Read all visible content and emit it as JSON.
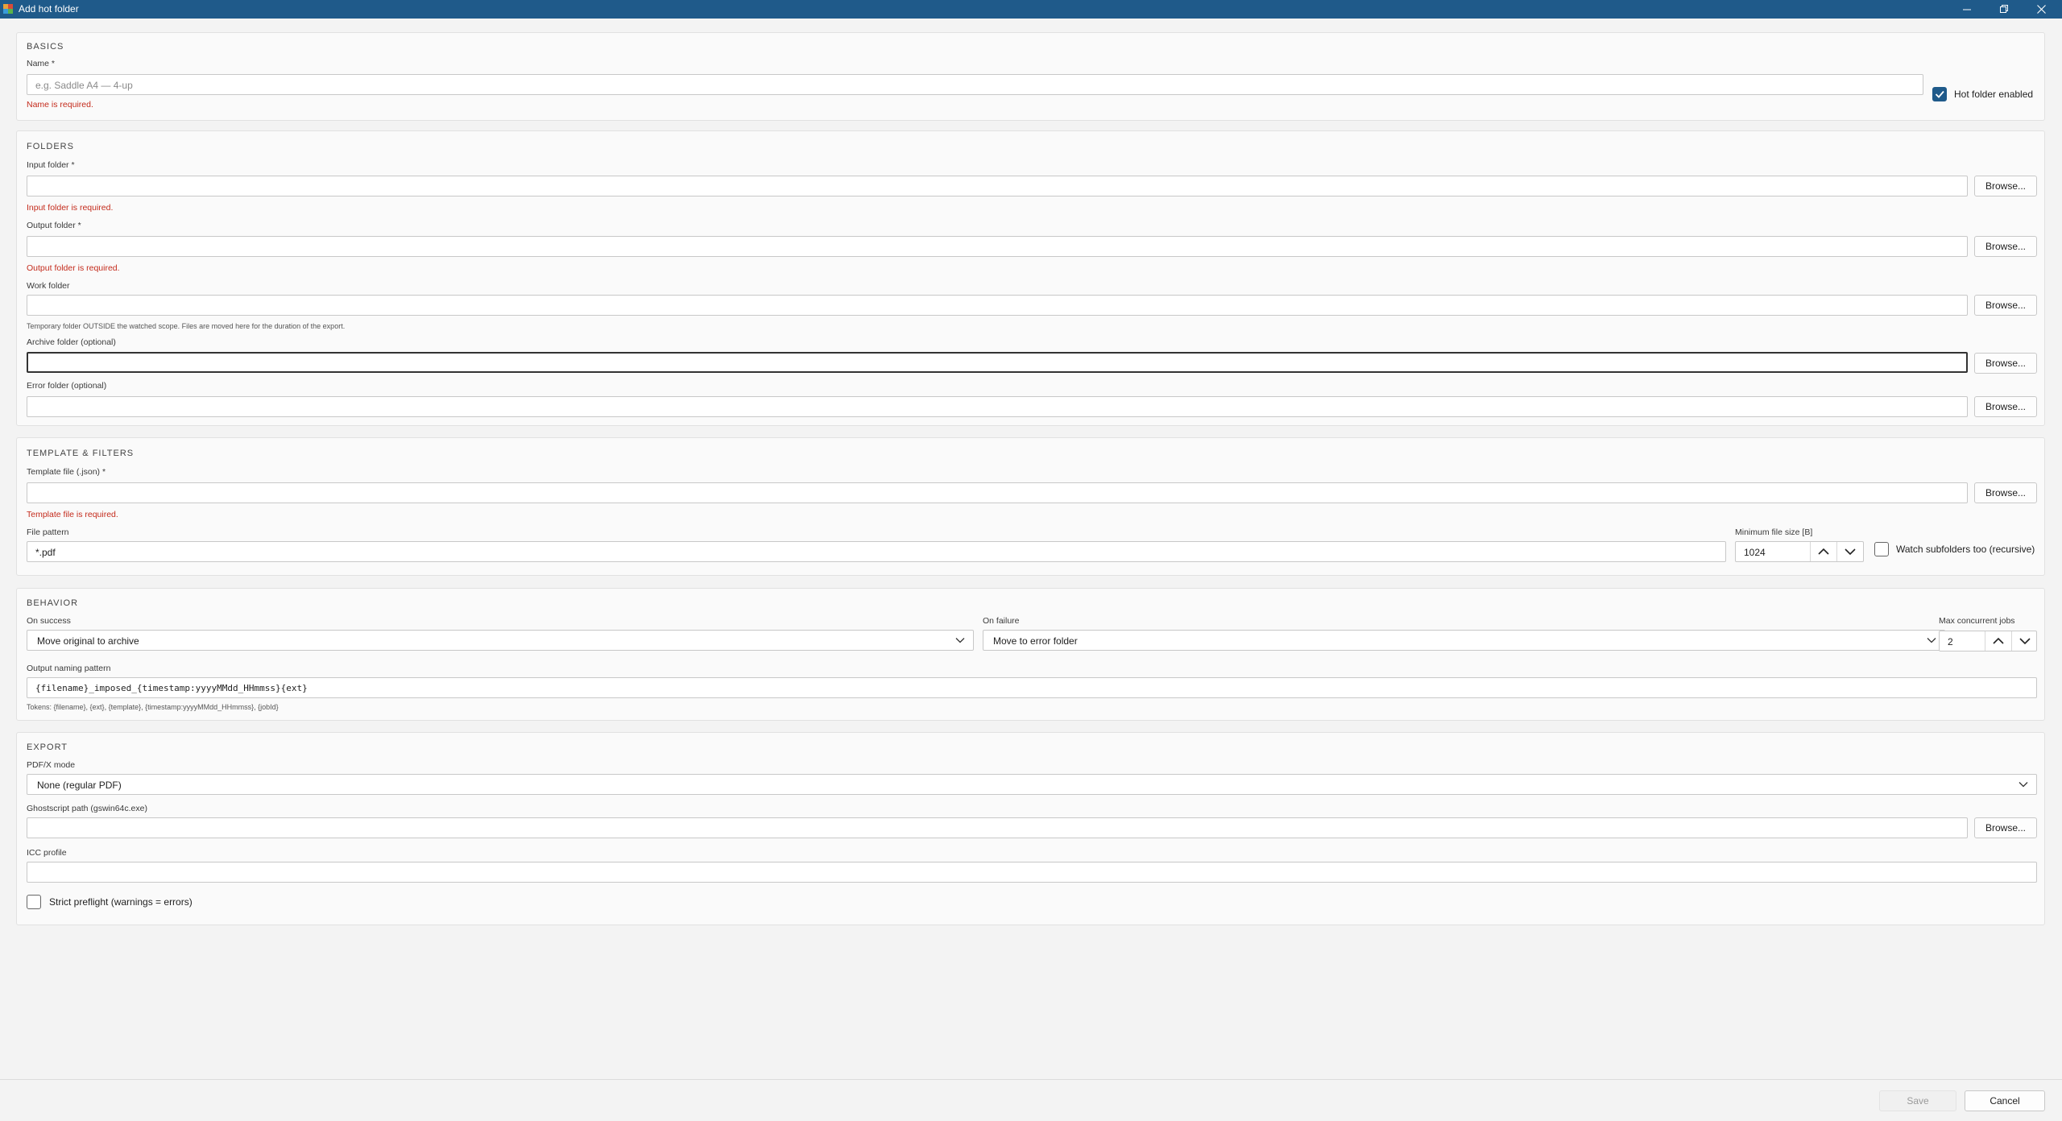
{
  "window": {
    "title": "Add hot folder",
    "controls": {
      "minimize_icon": "minimize-icon",
      "maximize_icon": "restore-icon",
      "close_icon": "close-icon"
    }
  },
  "basics": {
    "section_title": "BASICS",
    "name_label": "Name *",
    "name_placeholder": "e.g. Saddle A4 — 4-up",
    "name_error": "Name is required.",
    "enabled_label": "Hot folder enabled",
    "enabled_checked": true
  },
  "folders": {
    "section_title": "FOLDERS",
    "input_label": "Input folder *",
    "input_error": "Input folder is required.",
    "output_label": "Output folder *",
    "output_error": "Output folder is required.",
    "work_label": "Work folder",
    "work_hint": "Temporary folder OUTSIDE the watched scope. Files are moved here for the duration of the export.",
    "archive_label": "Archive folder (optional)",
    "error_label": "Error folder (optional)",
    "browse_label": "Browse..."
  },
  "template": {
    "section_title": "TEMPLATE & FILTERS",
    "template_label": "Template file (.json) *",
    "template_error": "Template file is required.",
    "pattern_label": "File pattern",
    "pattern_value": "*.pdf",
    "minsize_label": "Minimum file size [B]",
    "minsize_value": "1024",
    "recursive_label": "Watch subfolders too (recursive)",
    "recursive_checked": false
  },
  "behavior": {
    "section_title": "BEHAVIOR",
    "success_label": "On success",
    "success_value": "Move original to archive",
    "failure_label": "On failure",
    "failure_value": "Move to error folder",
    "jobs_label": "Max concurrent jobs",
    "jobs_value": "2",
    "naming_label": "Output naming pattern",
    "naming_value": "{filename}_imposed_{timestamp:yyyyMMdd_HHmmss}{ext}",
    "tokens_hint": "Tokens: {filename}, {ext}, {template}, {timestamp:yyyyMMdd_HHmmss}, {jobId}"
  },
  "export": {
    "section_title": "EXPORT",
    "pdfx_label": "PDF/X mode",
    "pdfx_value": "None (regular PDF)",
    "ghostscript_label": "Ghostscript path (gswin64c.exe)",
    "icc_label": "ICC profile",
    "strict_label": "Strict preflight (warnings = errors)",
    "strict_checked": false
  },
  "footer": {
    "save_label": "Save",
    "cancel_label": "Cancel"
  },
  "colors": {
    "titlebar": "#1f5a8a",
    "error": "#c42b1c",
    "checkbox": "#1f5a8a"
  }
}
